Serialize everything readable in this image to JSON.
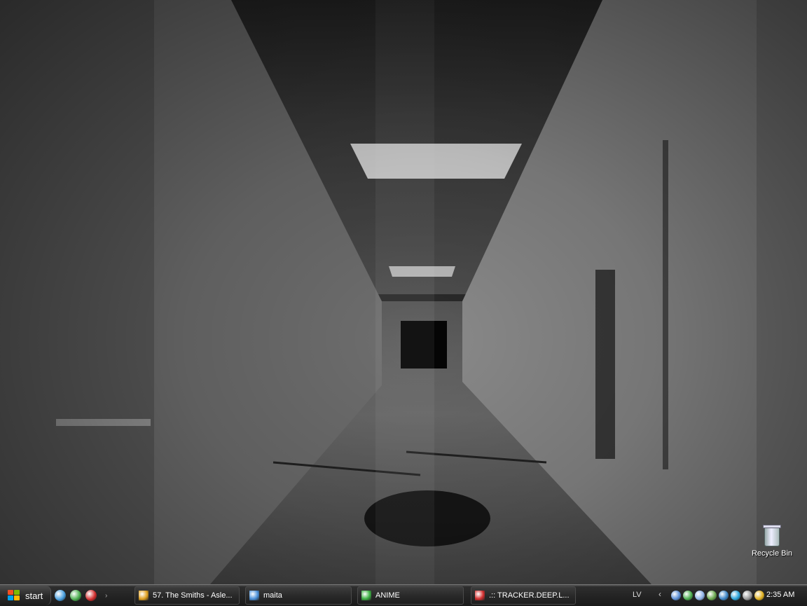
{
  "desktop": {
    "icons": [
      {
        "label": "Recycle Bin",
        "icon": "recycle-bin-icon"
      }
    ]
  },
  "taskbar": {
    "start_label": "start",
    "quick_launch": [
      {
        "icon": "desktop-icon",
        "color": "#4aa0e0"
      },
      {
        "icon": "utorrent-icon",
        "color": "#4caf50"
      },
      {
        "icon": "opera-icon",
        "color": "#d32f2f"
      }
    ],
    "tasks": [
      {
        "label": "57. The Smiths - Asle...",
        "icon": "winamp-icon",
        "color": "#e0a020"
      },
      {
        "label": "maita",
        "icon": "messenger-icon",
        "color": "#4a90d9"
      },
      {
        "label": "ANIME",
        "icon": "play-icon",
        "color": "#3cb043"
      },
      {
        "label": ".:: TRACKER.DEEP.L...",
        "icon": "opera-icon",
        "color": "#d32f2f"
      }
    ],
    "language": "LV",
    "tray_icons": [
      {
        "icon": "network-users-icon",
        "color": "#5b8fd6"
      },
      {
        "icon": "utorrent-tray-icon",
        "color": "#4caf50"
      },
      {
        "icon": "audio-icon",
        "color": "#8fb4e8"
      },
      {
        "icon": "network-icon",
        "color": "#6aa84f"
      },
      {
        "icon": "messenger-tray-icon",
        "color": "#3d85c6"
      },
      {
        "icon": "skype-icon",
        "color": "#29a3d9"
      },
      {
        "icon": "antivirus-icon",
        "color": "#999999"
      },
      {
        "icon": "update-icon",
        "color": "#e0b020"
      }
    ],
    "clock": "2:35 AM"
  }
}
